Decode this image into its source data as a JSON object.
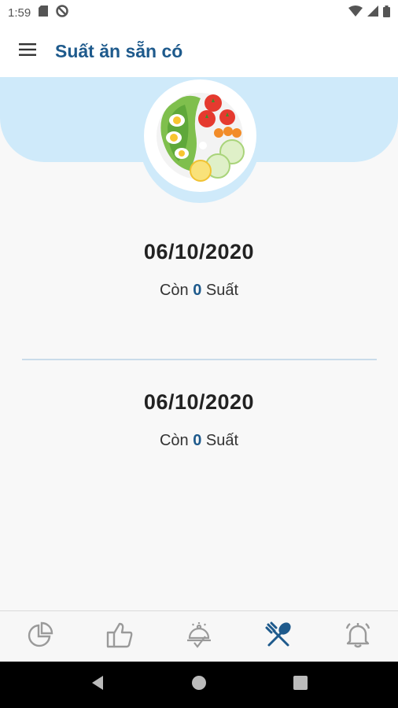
{
  "status_bar": {
    "time": "1:59",
    "icons": [
      "sd-card-icon",
      "do-not-disturb-icon",
      "wifi-icon",
      "signal-icon",
      "battery-icon"
    ]
  },
  "app_bar": {
    "menu_icon": "hamburger-menu-icon",
    "title": "Suất ăn sẵn có"
  },
  "hero": {
    "image": "salad-plate-illustration"
  },
  "entries": [
    {
      "date": "06/10/2020",
      "prefix": "Còn",
      "count": "0",
      "suffix": "Suất"
    },
    {
      "date": "06/10/2020",
      "prefix": "Còn",
      "count": "0",
      "suffix": "Suất"
    }
  ],
  "bottom_nav": {
    "items": [
      {
        "icon": "pie-chart-icon",
        "active": false
      },
      {
        "icon": "thumbs-up-icon",
        "active": false
      },
      {
        "icon": "food-dome-icon",
        "active": false
      },
      {
        "icon": "fork-knife-icon",
        "active": true
      },
      {
        "icon": "bell-icon",
        "active": false
      }
    ]
  },
  "colors": {
    "accent": "#1e5a8c",
    "hero_band": "#cfeafa",
    "inactive_icon": "#9a9a9a",
    "background": "#f8f8f8"
  },
  "system_nav": [
    "back-icon",
    "home-icon",
    "recents-icon"
  ]
}
